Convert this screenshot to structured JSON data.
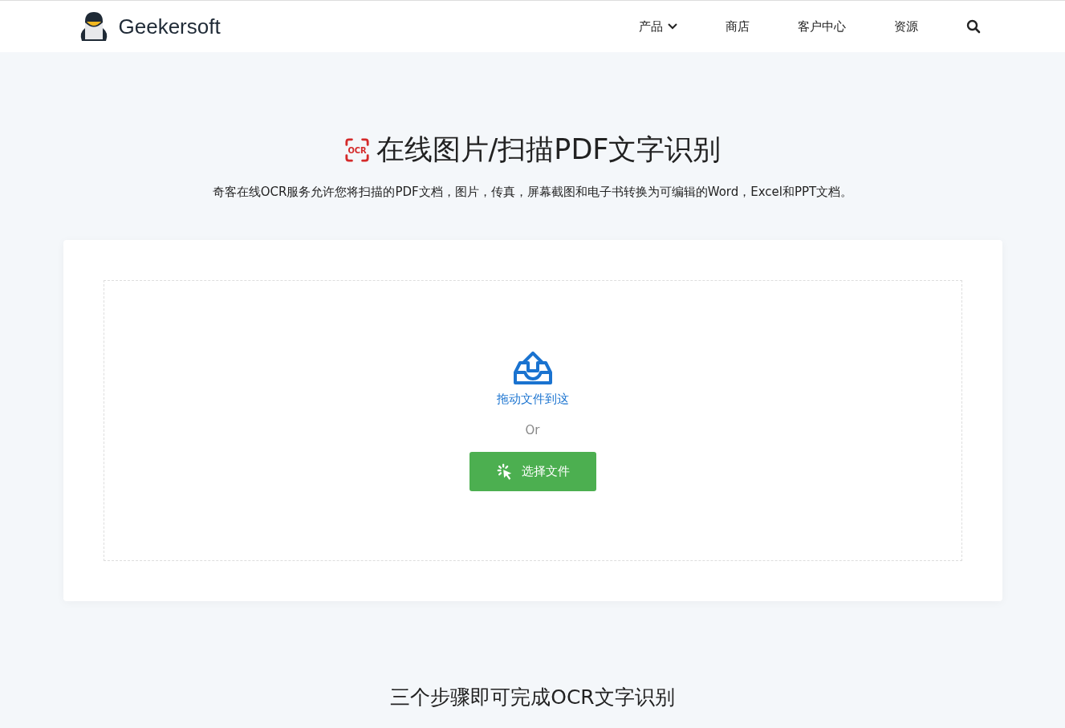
{
  "header": {
    "brand": "Geekersoft",
    "nav": [
      {
        "label": "产品",
        "dropdown": true
      },
      {
        "label": "商店",
        "dropdown": false
      },
      {
        "label": "客户中心",
        "dropdown": false
      },
      {
        "label": "资源",
        "dropdown": false
      }
    ]
  },
  "hero": {
    "icon_text": "OCR",
    "title": "在线图片/扫描PDF文字识别",
    "subtitle": "奇客在线OCR服务允许您将扫描的PDF文档，图片，传真，屏幕截图和电子书转换为可编辑的Word，Excel和PPT文档。"
  },
  "upload": {
    "drop_label": "拖动文件到这",
    "or": "Or",
    "button": "选择文件"
  },
  "steps": {
    "title": "三个步骤即可完成OCR文字识别"
  }
}
